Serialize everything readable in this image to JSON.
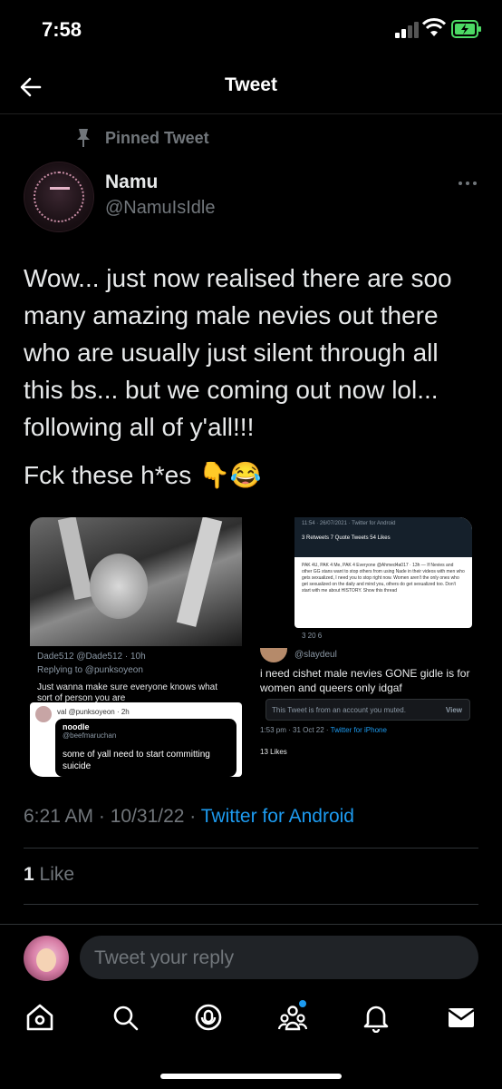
{
  "status": {
    "time": "7:58"
  },
  "nav": {
    "title": "Tweet"
  },
  "tweet": {
    "pinned_label": "Pinned Tweet",
    "display_name": "Namu",
    "handle": "@NamuIsIdle",
    "text": "Wow... just now realised there are soo many amazing male nevies out there who are usually just silent through all this bs... but we coming out now lol... following all of y'all!!!",
    "text2": "Fck these h*es 👇😂",
    "timestamp": "6:21 AM · 10/31/22 · ",
    "source": "Twitter for Android",
    "likes_count": "1",
    "likes_label": " Like"
  },
  "media": {
    "left": {
      "replying_meta": "Dade512 @Dade512 · 10h",
      "replying_to": "Replying to @punksoyeon",
      "reply_text": "Just wanna make sure everyone knows what sort of person you are",
      "quote_header": "val @punksoyeon · 2h",
      "quote_name": "noodle",
      "quote_handle": "@beefmaruchan",
      "quote_text": "some of yall need to start committing suicide"
    },
    "right": {
      "top_meta": "11:54 · 26/07/2021 · Twitter for Android",
      "top_stats": "3 Retweets  7 Quote Tweets  54 Likes",
      "top_body": "PAK 4U, PAK 4 Me, PAK 4 Everyone @Ahmed4a017 · 13h — If Nevies and other GG stans want to stop others from using Nade in their videos with men who gets sexualized, I need you to stop right now. Women aren't the only ones who get sexualized on the daily and mind you, others do get sexualized too. Don't start with me about HISTORY. Show this thread",
      "actions": "3     20     6",
      "reply_name": "@slaydeul",
      "reply_text": "i need cishet male nevies GONE gidle is for women and queers only idgaf",
      "muted_text": "This Tweet is from an account you muted.",
      "muted_view": "View",
      "reply_meta": "1:53 pm · 31 Oct 22 · ",
      "reply_source": "Twitter for iPhone",
      "reply_likes": "13 Likes"
    }
  },
  "reply": {
    "placeholder": "Tweet your reply"
  },
  "tabs": [
    "home-icon",
    "search-icon",
    "spaces-icon",
    "communities-icon",
    "notifications-icon",
    "messages-icon"
  ]
}
